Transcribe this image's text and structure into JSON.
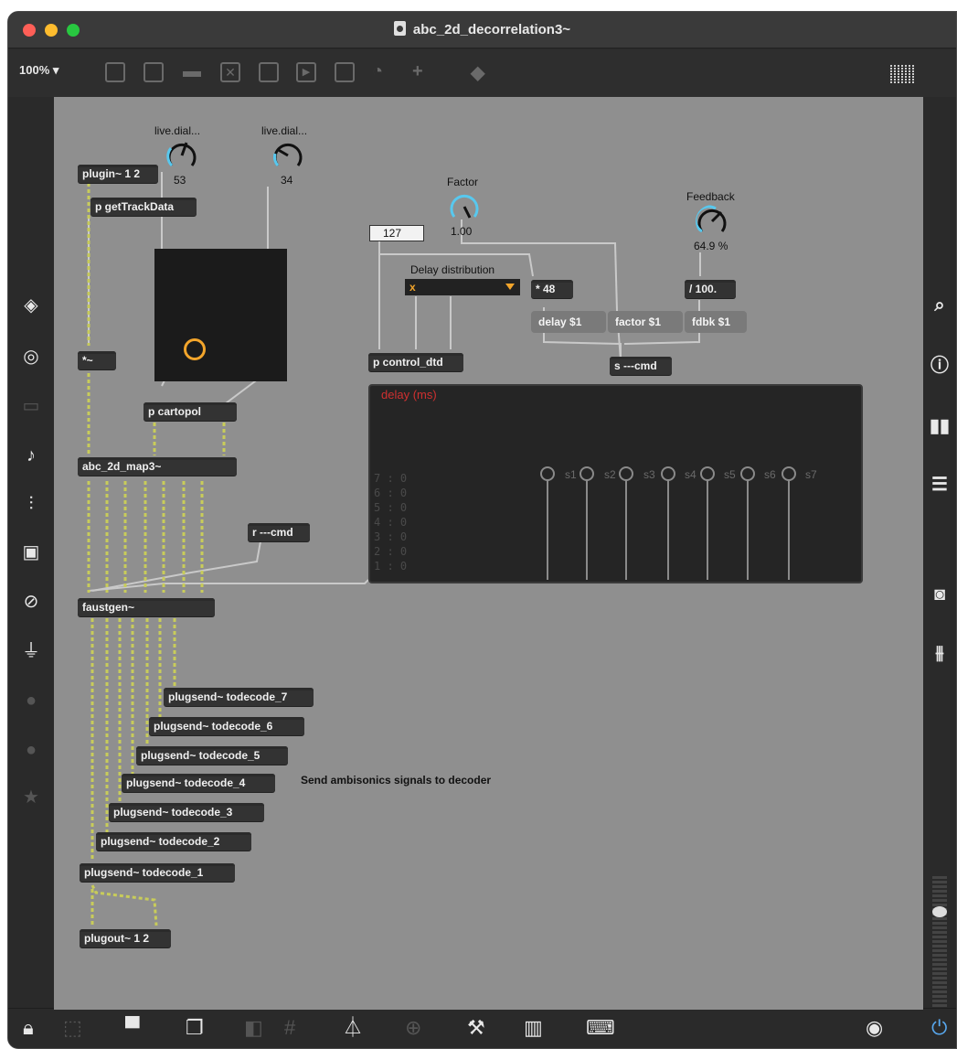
{
  "window": {
    "title": "abc_2d_decorrelation3~",
    "zoom": "100% ▾"
  },
  "toolbar": {
    "icons": [
      "presentation-icon",
      "comment-icon",
      "message-icon",
      "button-icon",
      "toggle-icon",
      "play-icon",
      "slider-icon",
      "dial-icon",
      "add-icon",
      "paint-bucket-icon"
    ]
  },
  "left_sidebar": {
    "icons": [
      "package-icon",
      "target-icon",
      "device-icon",
      "music-note-icon",
      "step-icon",
      "image-icon",
      "paperclip-icon",
      "plug-icon",
      "vimeo-icon",
      "b-icon",
      "star-icon"
    ]
  },
  "right_sidebar": {
    "icons": [
      "search-icon",
      "info-icon",
      "book-icon",
      "list-icon",
      "camera-icon",
      "mixer-icon"
    ]
  },
  "patch": {
    "dial1_label": "live.dial...",
    "dial1_value": "53",
    "dial2_label": "live.dial...",
    "dial2_value": "34",
    "plugin": "plugin~ 1 2",
    "get_track_data": "p getTrackData",
    "times_tilde": "*~",
    "cartopol": "p cartopol",
    "map3": "abc_2d_map3~",
    "receive_cmd": "r ---cmd",
    "faustgen": "faustgen~",
    "plugsend": [
      "plugsend~ todecode_7",
      "plugsend~ todecode_6",
      "plugsend~ todecode_5",
      "plugsend~ todecode_4",
      "plugsend~ todecode_3",
      "plugsend~ todecode_2",
      "plugsend~ todecode_1"
    ],
    "plugout": "plugout~ 1 2",
    "send_comment": "Send ambisonics signals to decoder",
    "number_box": "127",
    "factor_label": "Factor",
    "factor_value": "1.00",
    "feedback_label": "Feedback",
    "feedback_value": "64.9 %",
    "delay_distribution_label": "Delay distribution",
    "delay_distribution_value": "x",
    "times48": "* 48",
    "div100": "/ 100.",
    "msg_delay": "delay $1",
    "msg_factor": "factor $1",
    "msg_fdbk": "fdbk $1",
    "control_dtd": "p control_dtd",
    "send_cmd": "s ---cmd",
    "multislider_title": "delay (ms)",
    "multislider_rows": [
      "7 : 0",
      "6 : 0",
      "5 : 0",
      "4 : 0",
      "3 : 0",
      "2 : 0",
      "1 : 0"
    ],
    "multislider_labels": [
      "s1",
      "s2",
      "s3",
      "s4",
      "s5",
      "s6",
      "s7"
    ]
  },
  "colors": {
    "canvas": "#8f8f8f",
    "dial_accent": "#58c8ee",
    "pad_ring": "#f3a52b",
    "multislider_title": "#d03030"
  }
}
